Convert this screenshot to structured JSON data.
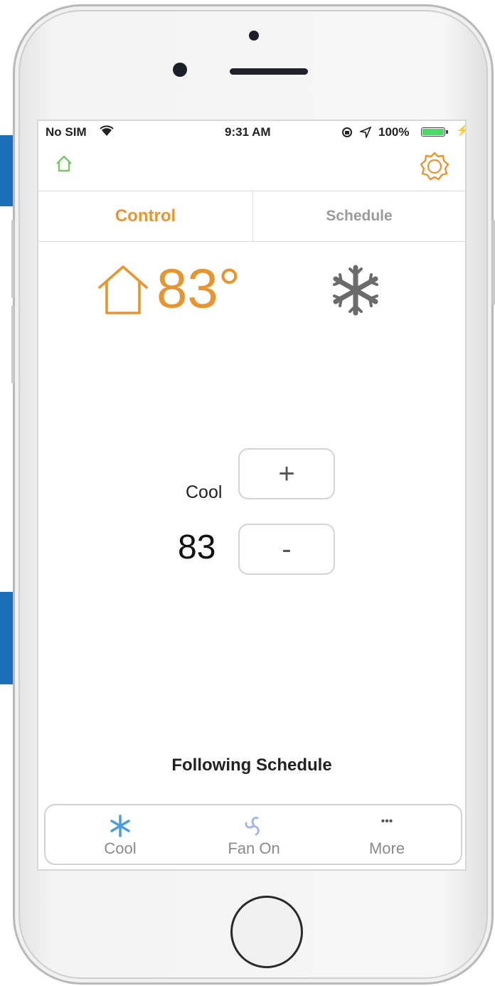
{
  "colors": {
    "accent": "#e8952f",
    "inactive": "#9a9a9a",
    "cool_icon": "#4a9be0",
    "side_bar": "#1b6fb8"
  },
  "status_bar": {
    "carrier": "No SIM",
    "time": "9:31 AM",
    "battery": "100%"
  },
  "nav": {
    "home_icon": "home-icon",
    "settings_icon": "gear-icon"
  },
  "tabs": [
    {
      "label": "Control",
      "active": true
    },
    {
      "label": "Schedule",
      "active": false
    }
  ],
  "current": {
    "temperature": "83°",
    "mode_icon": "snowflake-icon"
  },
  "setpoint": {
    "mode": "Cool",
    "value": "83",
    "plus": "+",
    "minus": "-"
  },
  "schedule_status": "Following Schedule",
  "bottom_bar": [
    {
      "label": "Cool",
      "icon": "snowflake-icon"
    },
    {
      "label": "Fan On",
      "icon": "fan-icon"
    },
    {
      "label": "More",
      "icon": "more-icon",
      "glyph": "•••"
    }
  ]
}
